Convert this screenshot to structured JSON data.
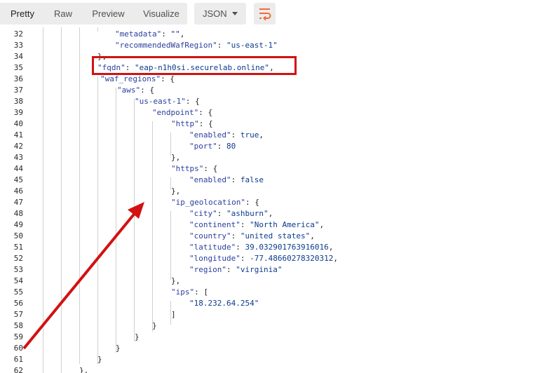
{
  "toolbar": {
    "tabs": [
      {
        "label": "Pretty",
        "active": true
      },
      {
        "label": "Raw",
        "active": false
      },
      {
        "label": "Preview",
        "active": false
      },
      {
        "label": "Visualize",
        "active": false
      }
    ],
    "format": "JSON",
    "wrap_icon": "wrap-lines-icon",
    "accent_color": "#f26b3a"
  },
  "annotation": {
    "box_color": "#d31111",
    "arrow_color": "#d31111"
  },
  "editor": {
    "line_numbers": [
      "32",
      "33",
      "34",
      "35",
      "36",
      "37",
      "38",
      "39",
      "40",
      "41",
      "42",
      "43",
      "44",
      "45",
      "46",
      "47",
      "48",
      "49",
      "50",
      "51",
      "52",
      "53",
      "54",
      "55",
      "56",
      "57",
      "58",
      "59",
      "60",
      "61",
      "62"
    ],
    "lines": [
      "\"metadata\": \"\",",
      "\"recommendedWafRegion\": \"us-east-1\"",
      "},",
      "\"fqdn\": \"eap-n1h0si.securelab.online\",",
      "\"waf_regions\": {",
      "\"aws\": {",
      "\"us-east-1\": {",
      "\"endpoint\": {",
      "\"http\": {",
      "\"enabled\": true,",
      "\"port\": 80",
      "},",
      "\"https\": {",
      "\"enabled\": false",
      "},",
      "\"ip_geolocation\": {",
      "\"city\": \"ashburn\",",
      "\"continent\": \"North America\",",
      "\"country\": \"united states\",",
      "\"latitude\": 39.032901763916016,",
      "\"longitude\": -77.48660278320312,",
      "\"region\": \"virginia\"",
      "},",
      "\"ips\": [",
      "\"18.232.64.254\"",
      "]",
      "}",
      "}",
      "}",
      "}",
      "},"
    ]
  }
}
